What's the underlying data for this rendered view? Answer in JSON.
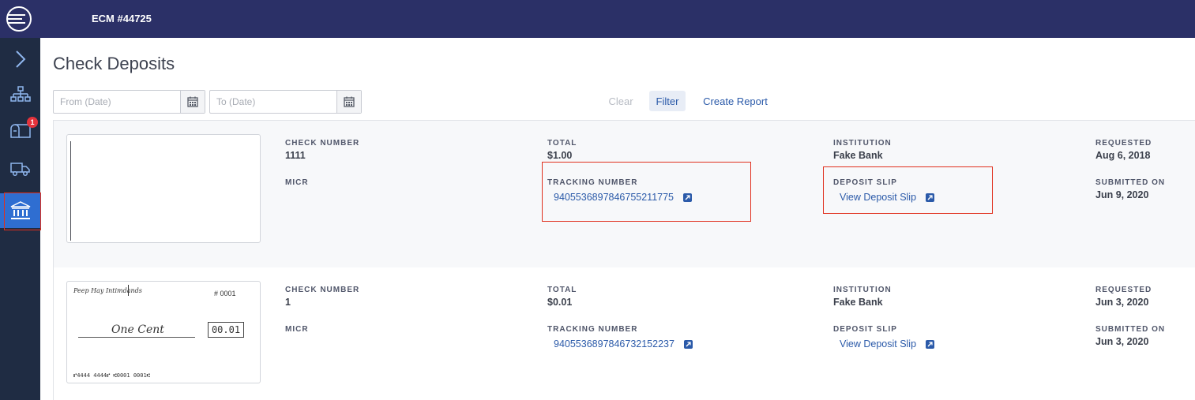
{
  "header": {
    "title": "ECM #44725"
  },
  "sidebar": {
    "items": [
      {
        "icon": "chevron-right-icon"
      },
      {
        "icon": "org-chart-icon"
      },
      {
        "icon": "mailbox-icon",
        "badge": "1"
      },
      {
        "icon": "truck-icon"
      },
      {
        "icon": "bank-icon",
        "active": true
      }
    ]
  },
  "page": {
    "title": "Check Deposits"
  },
  "filters": {
    "from_placeholder": "From (Date)",
    "to_placeholder": "To (Date)",
    "clear_label": "Clear",
    "filter_label": "Filter",
    "report_label": "Create Report"
  },
  "labels": {
    "check_number": "CHECK NUMBER",
    "micr": "MICR",
    "total": "TOTAL",
    "tracking_number": "TRACKING NUMBER",
    "institution": "INSTITUTION",
    "deposit_slip": "DEPOSIT SLIP",
    "requested": "REQUESTED",
    "submitted_on": "SUBMITTED ON"
  },
  "deposits": [
    {
      "check_number": "1111",
      "total": "$1.00",
      "tracking_number": "9405536897846755211775",
      "institution": "Fake Bank",
      "deposit_slip_link": "View Deposit Slip",
      "requested": "Aug 6, 2018",
      "submitted_on": "Jun 9, 2020"
    },
    {
      "check_number": "1",
      "total": "$0.01",
      "tracking_number": "9405536897846732152237",
      "institution": "Fake Bank",
      "deposit_slip_link": "View Deposit Slip",
      "requested": "Jun 3, 2020",
      "submitted_on": "Jun 3, 2020",
      "check_image": {
        "payee": "Peep Hay Intimdands",
        "number": "# 0001",
        "amount_words": "One Cent",
        "amount_box": "00.01",
        "micr_line": "⑈4444 4444⑈ ⑆0001 0001⑆"
      }
    }
  ]
}
